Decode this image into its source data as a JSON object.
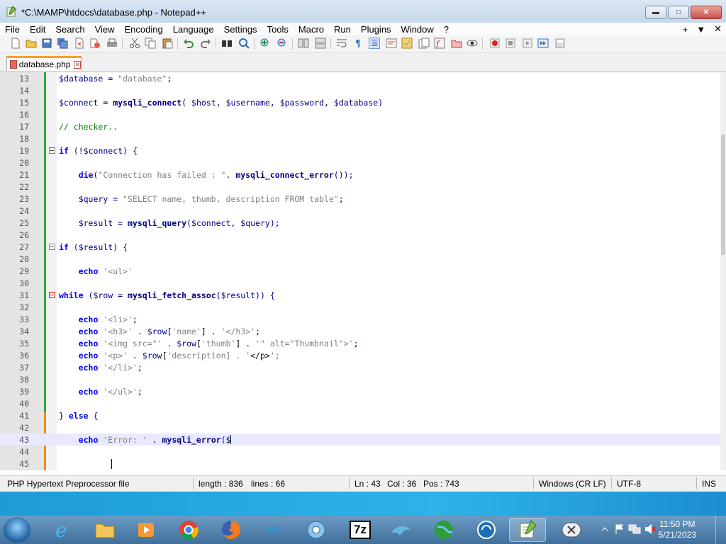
{
  "window": {
    "title": "*C:\\MAMP\\htdocs\\database.php - Notepad++"
  },
  "menu": {
    "items": [
      "File",
      "Edit",
      "Search",
      "View",
      "Encoding",
      "Language",
      "Settings",
      "Tools",
      "Macro",
      "Run",
      "Plugins",
      "Window",
      "?"
    ],
    "right": [
      "+",
      "▼",
      "✕"
    ]
  },
  "tabs": [
    {
      "label": "database.php",
      "close": "✕"
    }
  ],
  "editor": {
    "lines": [
      {
        "n": "13",
        "t": "$database = \"database\";"
      },
      {
        "n": "14",
        "t": ""
      },
      {
        "n": "15",
        "t": "$connect = mysqli_connect( $host, $username, $password, $database)"
      },
      {
        "n": "16",
        "t": ""
      },
      {
        "n": "17",
        "t": "// checker.."
      },
      {
        "n": "18",
        "t": ""
      },
      {
        "n": "19",
        "t": "if (!$connect) {"
      },
      {
        "n": "20",
        "t": ""
      },
      {
        "n": "21",
        "t": "    die(\"Connection has failed : \". mysqli_connect_error());"
      },
      {
        "n": "22",
        "t": ""
      },
      {
        "n": "23",
        "t": "    $query = \"SELECT name, thumb, description FROM table\";"
      },
      {
        "n": "24",
        "t": ""
      },
      {
        "n": "25",
        "t": "    $result = mysqli_query($connect, $query);"
      },
      {
        "n": "26",
        "t": ""
      },
      {
        "n": "27",
        "t": "if ($result) {"
      },
      {
        "n": "28",
        "t": ""
      },
      {
        "n": "29",
        "t": "    echo '<ul>'"
      },
      {
        "n": "30",
        "t": ""
      },
      {
        "n": "31",
        "t": "while ($row = mysqli_fetch_assoc($result)) {"
      },
      {
        "n": "32",
        "t": ""
      },
      {
        "n": "33",
        "t": "    echo '<li>';"
      },
      {
        "n": "34",
        "t": "    echo '<h3>' . $row['name'] . '</h3>';"
      },
      {
        "n": "35",
        "t": "    echo '<img src=\"' . $row['thumb'] . '\" alt=\"Thumbnail\">';"
      },
      {
        "n": "36",
        "t": "    echo '<p>' . $row['description] . '</p>';"
      },
      {
        "n": "37",
        "t": "    echo '</li>';"
      },
      {
        "n": "38",
        "t": ""
      },
      {
        "n": "39",
        "t": "    echo '</ul>';"
      },
      {
        "n": "40",
        "t": ""
      },
      {
        "n": "41",
        "t": "} else {"
      },
      {
        "n": "42",
        "t": ""
      },
      {
        "n": "43",
        "t": "    echo 'Error: ' . mysqli_error($"
      },
      {
        "n": "44",
        "t": ""
      },
      {
        "n": "45",
        "t": ""
      }
    ],
    "current_line": "43",
    "fold_lines": [
      "19",
      "27",
      "31"
    ],
    "active_fold": "31"
  },
  "status": {
    "file_type": "PHP Hypertext Preprocessor file",
    "length": "length : 836",
    "lines": "lines : 66",
    "ln": "Ln : 43",
    "col": "Col : 36",
    "pos": "Pos : 743",
    "eol": "Windows (CR LF)",
    "encoding": "UTF-8",
    "mode": "INS"
  },
  "taskbar": {
    "clock_time": "11:50 PM",
    "clock_date": "5/21/2023",
    "apps": [
      "internet-explorer-icon",
      "file-explorer-icon",
      "media-player-icon",
      "chrome-icon",
      "firefox-icon",
      "mysql-workbench-icon",
      "control-panel-icon",
      "7zip-icon",
      "mysql-icon",
      "network-globe-icon",
      "remote-desktop-icon",
      "notepad-plus-plus-icon",
      "xampp-icon"
    ],
    "app_7zip_label": "7z"
  },
  "colors": {
    "keyword": "#0000ff",
    "function": "#000080",
    "string": "#808080",
    "variable": "#000080",
    "comment": "#008000",
    "accent": "#f6a02c"
  }
}
